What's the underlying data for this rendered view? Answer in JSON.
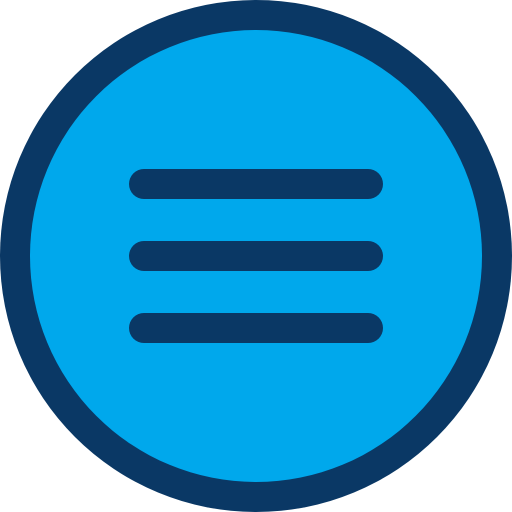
{
  "icon": {
    "name": "hamburger-menu-icon",
    "shape": "circle-button",
    "line_count": 3
  },
  "colors": {
    "ring": "#0a3865",
    "fill": "#00a8ec",
    "lines": "#0a3865",
    "background": "#ffffff"
  }
}
